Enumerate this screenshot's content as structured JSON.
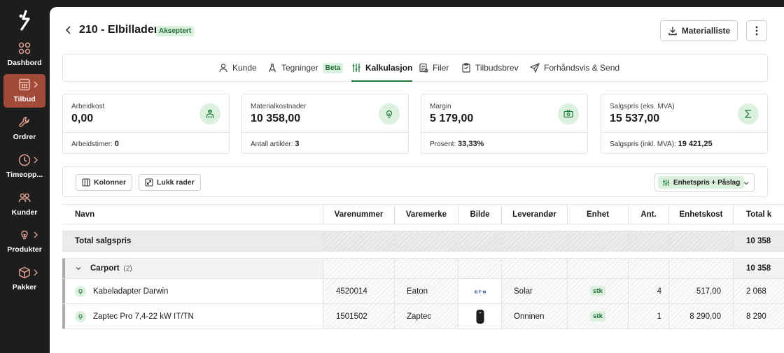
{
  "sidebar": {
    "items": [
      {
        "label": "Dashbord",
        "icon": "grid-icon",
        "active": false,
        "chevron": false
      },
      {
        "label": "Tilbud",
        "icon": "calculator-icon",
        "active": true,
        "chevron": true
      },
      {
        "label": "Ordrer",
        "icon": "wrench-icon",
        "active": false,
        "chevron": false
      },
      {
        "label": "Timeopp...",
        "icon": "clock-icon",
        "active": false,
        "chevron": true
      },
      {
        "label": "Kunder",
        "icon": "users-icon",
        "active": false,
        "chevron": false
      },
      {
        "label": "Produkter",
        "icon": "lightbulb-icon",
        "active": false,
        "chevron": true
      },
      {
        "label": "Pakker",
        "icon": "box-icon",
        "active": false,
        "chevron": true
      }
    ]
  },
  "header": {
    "title": "210 - Elbillader",
    "status": "Akseptert",
    "material_button": "Materialliste"
  },
  "tabs": [
    {
      "label": "Kunde",
      "icon": "user-icon",
      "active": false
    },
    {
      "label": "Tegninger",
      "icon": "compass-icon",
      "badge": "Beta",
      "active": false
    },
    {
      "label": "Kalkulasjon",
      "icon": "sliders-icon",
      "active": true
    },
    {
      "label": "Filer",
      "icon": "file-icon",
      "active": false
    },
    {
      "label": "Tilbudsbrev",
      "icon": "clipboard-icon",
      "active": false
    },
    {
      "label": "Forhåndsvis & Send",
      "icon": "send-icon",
      "active": false
    }
  ],
  "cards": [
    {
      "label": "Arbeidkost",
      "value": "0,00",
      "foot_label": "Arbeidstimer:",
      "foot_value": "0",
      "icon": "worker-icon"
    },
    {
      "label": "Materialkostnader",
      "value": "10 358,00",
      "foot_label": "Antall artikler:",
      "foot_value": "3",
      "icon": "lightbulb-icon"
    },
    {
      "label": "Margin",
      "value": "5 179,00",
      "foot_label": "Prosent:",
      "foot_value": "33,33%",
      "icon": "cash-icon"
    },
    {
      "label": "Salgspris (eks. MVA)",
      "value": "15 537,00",
      "foot_label": "Salgspris (inkl. MVA):",
      "foot_value": "19 421,25",
      "icon": "sigma-icon"
    }
  ],
  "toolbar": {
    "columns_label": "Kolonner",
    "close_rows_label": "Lukk rader",
    "pricing_mode": "Enhetspris + Påslag"
  },
  "table": {
    "headers": [
      "Navn",
      "Varenummer",
      "Varemerke",
      "Bilde",
      "Leverandør",
      "Enhet",
      "Ant.",
      "Enhetskost",
      "Total k"
    ],
    "total_row": {
      "label": "Total salgspris",
      "total": "10 358"
    },
    "group": {
      "name": "Carport",
      "count": "(2)",
      "total": "10 358"
    },
    "rows": [
      {
        "name": "Kabeladapter Darwin",
        "sku": "4520014",
        "brand": "Eaton",
        "image": "eaton-logo",
        "supplier": "Solar",
        "unit": "stk",
        "qty": "4",
        "unit_cost": "517,00",
        "total": "2 068"
      },
      {
        "name": "Zaptec Pro 7,4-22 kW IT/TN",
        "sku": "1501502",
        "brand": "Zaptec",
        "image": "zaptec-charger",
        "supplier": "Onninen",
        "unit": "stk",
        "qty": "1",
        "unit_cost": "8 290,00",
        "total": "8 290"
      }
    ]
  },
  "colors": {
    "accent_green": "#1f7a3a",
    "active_nav": "#a34b3a",
    "badge_bg": "#dcf0de"
  }
}
